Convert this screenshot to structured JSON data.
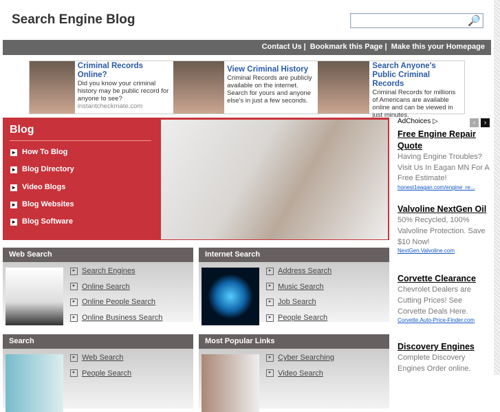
{
  "header": {
    "title": "Search Engine Blog",
    "search_placeholder": ""
  },
  "nav": [
    "Contact Us",
    "Bookmark this Page",
    "Make this your Homepage"
  ],
  "top_ad": [
    {
      "title": "Criminal Records Online?",
      "text": "Did you know your criminal history may be public record for anyone to see?",
      "url": "instantcheckmate.com"
    },
    {
      "title": "View Criminal History",
      "text": "Criminal Records are publicly available on the internet. Search for yours and anyone else's in just a few seconds."
    },
    {
      "title": "Search Anyone's Public Criminal Records",
      "text": "Criminal Records for millions of Americans are available online and can be viewed in just minutes."
    }
  ],
  "blog": {
    "title": "Blog",
    "items": [
      "How To Blog",
      "Blog Directory",
      "Video Blogs",
      "Blog Websites",
      "Blog Software"
    ]
  },
  "sidebar": {
    "adchoices": "AdChoices",
    "ads": [
      {
        "title": "Free Engine Repair Quote",
        "text": "Having Engine Troubles? Visit Us In Eagan MN For A Free Estimate!",
        "url": "honest1eagan.com/engine_re..."
      },
      {
        "title": "Valvoline NextGen Oil",
        "text": "50% Recycled, 100% Valvoline Protection. Save $10 Now!",
        "url": "NextGen.Valvoline.com"
      },
      {
        "title": "Corvette Clearance",
        "text": "Chevrolet Dealers are Cutting Prices! See Corvette Deals Here.",
        "url": "Corvette.Auto-Price-Finder.com"
      },
      {
        "title": "Discovery Engines",
        "text": "Complete Discovery Engines Order online.",
        "url": ""
      }
    ]
  },
  "boxes": [
    {
      "title": "Web Search",
      "links": [
        "Search Engines",
        "Online Search",
        "Online People Search",
        "Online Business Search"
      ]
    },
    {
      "title": "Internet Search",
      "links": [
        "Address Search",
        "Music Search",
        "Job Search",
        "People Search"
      ]
    },
    {
      "title": "Search",
      "links": [
        "Web Search",
        "People Search"
      ]
    },
    {
      "title": "Most Popular Links",
      "links": [
        "Cyber Searching",
        "Video Search"
      ]
    }
  ]
}
